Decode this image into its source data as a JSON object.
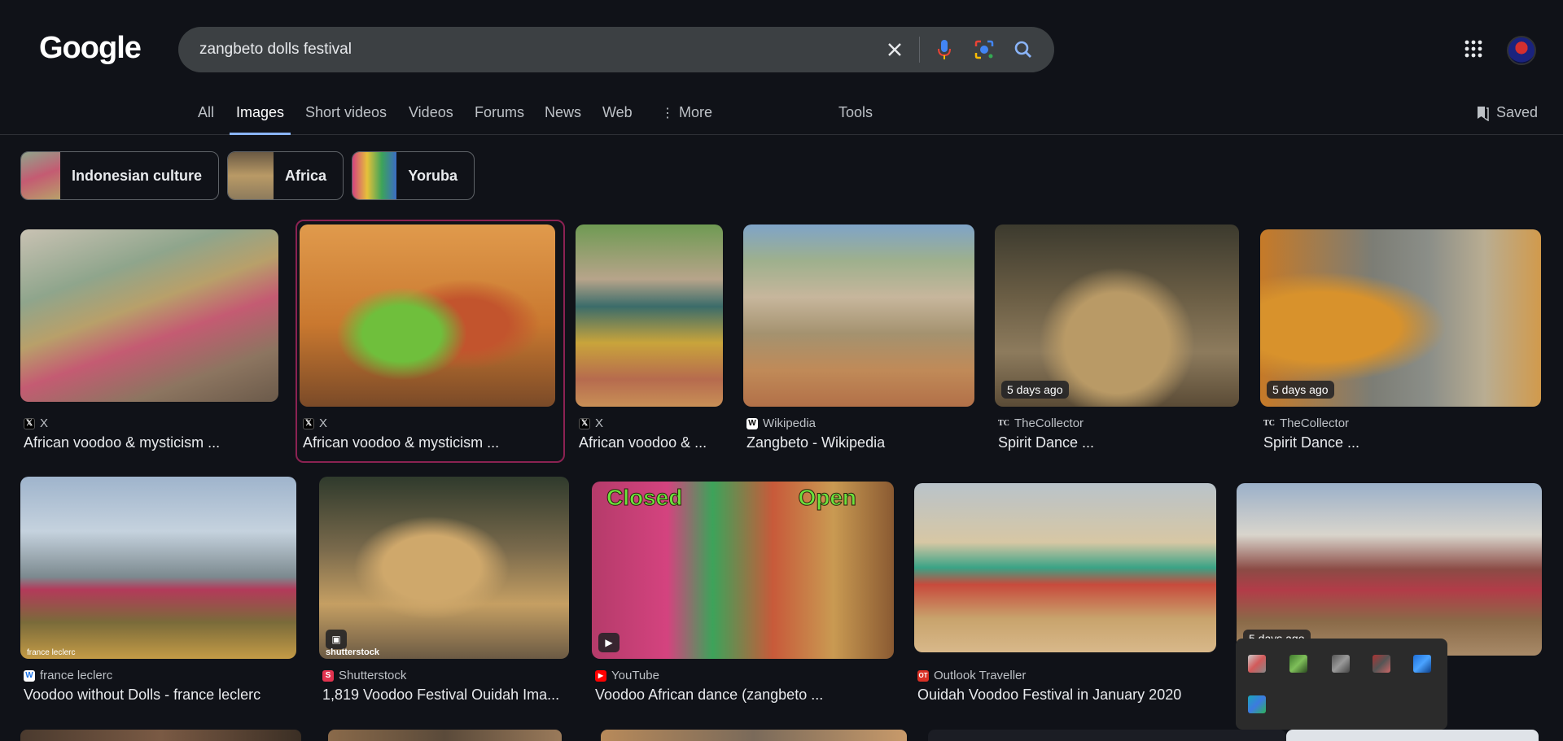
{
  "header": {
    "logo": "Google",
    "search_query": "zangbeto dolls festival",
    "tabs": [
      "All",
      "Images",
      "Short videos",
      "Videos",
      "Forums",
      "News",
      "Web",
      "More",
      "Tools"
    ],
    "active_tab": "Images",
    "saved_label": "Saved"
  },
  "chips": [
    {
      "label": "Indonesian culture"
    },
    {
      "label": "Africa"
    },
    {
      "label": "Yoruba"
    }
  ],
  "results": [
    {
      "source": "X",
      "title": "African voodoo & mysticism ...",
      "badge": ""
    },
    {
      "source": "X",
      "title": "African voodoo & mysticism ...",
      "badge": ""
    },
    {
      "source": "X",
      "title": "African voodoo & ...",
      "badge": ""
    },
    {
      "source": "Wikipedia",
      "title": "Zangbeto - Wikipedia",
      "badge": ""
    },
    {
      "source": "TheCollector",
      "title": "Spirit Dance ...",
      "badge": "5 days ago"
    },
    {
      "source": "TheCollector",
      "title": "Spirit Dance ...",
      "badge": "5 days ago"
    },
    {
      "source": "france leclerc",
      "title": "Voodoo without Dolls - france leclerc",
      "badge": "",
      "watermark": "france leclerc"
    },
    {
      "source": "Shutterstock",
      "title": "1,819 Voodoo Festival Ouidah Ima...",
      "badge": "",
      "watermark": "shutterstock"
    },
    {
      "source": "YouTube",
      "title": "Voodoo African dance (zangbeto ...",
      "badge": "",
      "overlay_left": "Closed",
      "overlay_right": "Open"
    },
    {
      "source": "Outlook Traveller",
      "title": "Ouidah Voodoo Festival in January 2020",
      "badge": ""
    },
    {
      "source": "",
      "title": "",
      "badge": "5 days ago"
    }
  ],
  "colors": {
    "background": "#101218",
    "search_bar": "#3c4043",
    "accent_tab": "#8ab4f8",
    "selected_border": "#8b2252"
  }
}
